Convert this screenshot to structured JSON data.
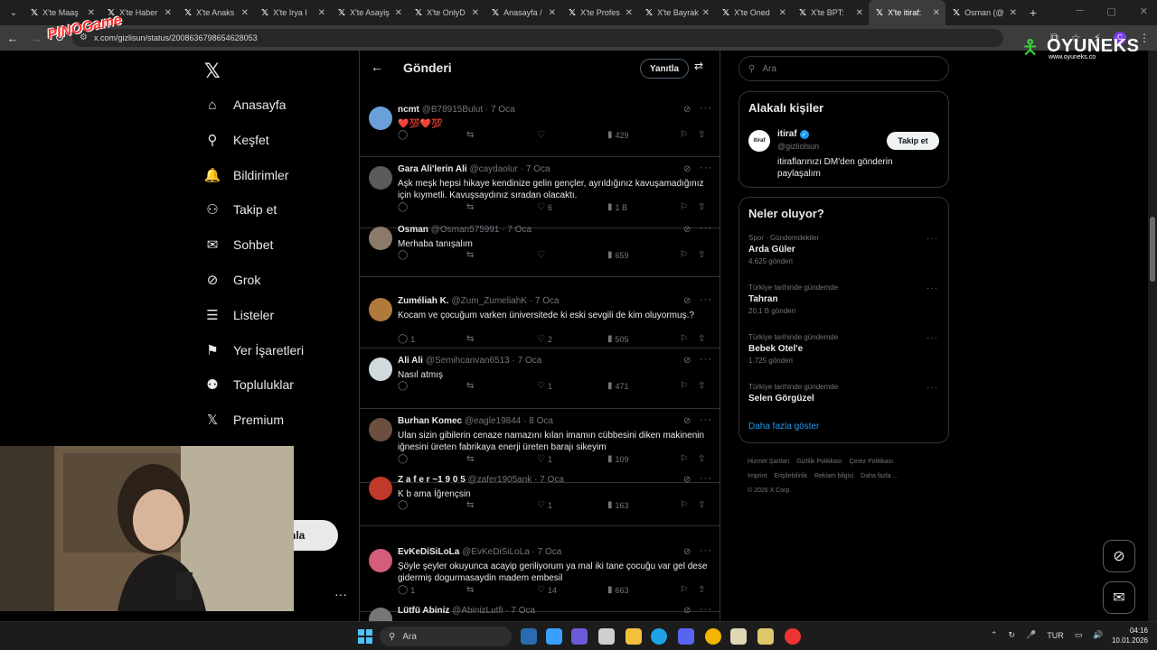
{
  "browser": {
    "tabs": [
      {
        "title": "X'te Maaş",
        "active": false
      },
      {
        "title": "X'te Haber",
        "active": false
      },
      {
        "title": "X'te Anaks",
        "active": false
      },
      {
        "title": "X'te Irya I",
        "active": false
      },
      {
        "title": "X'te Asayiş",
        "active": false
      },
      {
        "title": "X'te OnlyD",
        "active": false
      },
      {
        "title": "Anasayfa /",
        "active": false
      },
      {
        "title": "X'te Profes",
        "active": false
      },
      {
        "title": "X'te Bayrak",
        "active": false
      },
      {
        "title": "X'te Oned",
        "active": false
      },
      {
        "title": "X'te BPT:",
        "active": false
      },
      {
        "title": "X'te itiraf:",
        "active": true
      },
      {
        "title": "Osman (@",
        "active": false
      }
    ],
    "new_tab": "+",
    "url": "x.com/gizlisun/status/2008636798654628053"
  },
  "overlays": {
    "left_logo": "PINOGame",
    "right_logo": "OYUNEKS",
    "right_logo_sub": "www.oyuneks.co"
  },
  "x_nav": {
    "logo": "𝕏",
    "items": [
      {
        "label": "Anasayfa",
        "icon": "home-icon",
        "glyph": "⌂"
      },
      {
        "label": "Keşfet",
        "icon": "search-icon",
        "glyph": "⚲"
      },
      {
        "label": "Bildirimler",
        "icon": "bell-icon",
        "glyph": "🔔"
      },
      {
        "label": "Takip et",
        "icon": "follow-icon",
        "glyph": "⚇"
      },
      {
        "label": "Sohbet",
        "icon": "mail-icon",
        "glyph": "✉"
      },
      {
        "label": "Grok",
        "icon": "grok-icon",
        "glyph": "⊘"
      },
      {
        "label": "Listeler",
        "icon": "list-icon",
        "glyph": "☰"
      },
      {
        "label": "Yer İşaretleri",
        "icon": "bookmark-icon",
        "glyph": "⚑"
      },
      {
        "label": "Topluluklar",
        "icon": "communities-icon",
        "glyph": "⚉"
      },
      {
        "label": "Premium",
        "icon": "x-premium-icon",
        "glyph": "𝕏"
      }
    ],
    "post_button_partial": "nla",
    "more": "···"
  },
  "main": {
    "title": "Gönderi",
    "reply_label": "Yanıtla",
    "tweets": [
      {
        "name": "ncmt",
        "handle": "@B78915Bulut",
        "date": "7 Oca",
        "text": "❤️💯❤️💯",
        "reply": "",
        "retweet": "",
        "like": "",
        "views": "429",
        "av": "#6a9fd8"
      },
      {
        "name": "Gara Ali'lerin Ali",
        "handle": "@caydaolur",
        "date": "7 Oca",
        "text": "Aşk meşk hepsi hikaye kendinize gelin gençler, ayrıldığınız kavuşamadığınız için kıymetli. Kavuşsaydınız sıradan olacaktı.",
        "reply": "",
        "retweet": "",
        "like": "6",
        "views": "1 B",
        "av": "#5a5a5a"
      },
      {
        "name": "Osman",
        "handle": "@Osman575991",
        "date": "7 Oca",
        "text": "Merhaba tanışalım",
        "reply": "",
        "retweet": "",
        "like": "",
        "views": "659",
        "av": "#8b7a6a"
      },
      {
        "name": "Zuméliah K.",
        "handle": "@Zum_ZumeliahK",
        "date": "7 Oca",
        "text": "Kocam ve çocuğum varken üniversitede ki eski sevgili de kim oluyormuş.?",
        "reply": "1",
        "retweet": "",
        "like": "2",
        "views": "505",
        "av": "#b07a3a"
      },
      {
        "name": "Ali Ali",
        "handle": "@Semihcanvan6513",
        "date": "7 Oca",
        "text": "Nasıl atmış",
        "reply": "",
        "retweet": "",
        "like": "1",
        "views": "471",
        "av": "#cfd9de"
      },
      {
        "name": "Burhan Komec",
        "handle": "@eagle19844",
        "date": "8 Oca",
        "text": "Ulan sizin gibilerin cenaze namazını kılan imamın cübbesini diken makinenin iğnesini üreten fabrikaya enerji üreten barajı sikeyim",
        "reply": "",
        "retweet": "",
        "like": "1",
        "views": "109",
        "av": "#6b5040"
      },
      {
        "name": "Z a f e r ~1 9 0 5",
        "handle": "@zafer1905ank",
        "date": "7 Oca",
        "text": "K b ama İğrençsin",
        "reply": "",
        "retweet": "",
        "like": "1",
        "views": "163",
        "av": "#c0392b"
      },
      {
        "name": "EvKeDiSiLoLa",
        "handle": "@EvKeDiSiLoLa",
        "date": "7 Oca",
        "text": "Şöyle şeyler okuyunca acayip geriliyorum ya mal iki tane çocuğu var gel dese gidermiş dogurmasaydin madem  embesil",
        "reply": "1",
        "retweet": "",
        "like": "14",
        "views": "663",
        "av": "#d35d7a"
      },
      {
        "name": "Lütfü Abiniz",
        "handle": "@AbinizLutfi",
        "date": "7 Oca",
        "text": "",
        "reply": "",
        "retweet": "",
        "like": "",
        "views": "",
        "av": "#777"
      }
    ]
  },
  "right": {
    "search_placeholder": "Ara",
    "related_title": "Alakalı kişiler",
    "related": {
      "avatar_text": "itiraf",
      "name": "itiraf",
      "handle": "@gizliolsun",
      "bio": "itiraflarınızı DM'den gönderin paylaşalım",
      "follow_label": "Takip et"
    },
    "trends_title": "Neler oluyor?",
    "trends": [
      {
        "context": "Spor · Gündemdekiler",
        "name": "Arda Güler",
        "count": "4.625 gönderi"
      },
      {
        "context": "Türkiye tarihinde gündemde",
        "name": "Tahran",
        "count": "20,1 B gönderi"
      },
      {
        "context": "Türkiye tarihinde gündemde",
        "name": "Bebek Otel'e",
        "count": "1.725 gönderi"
      },
      {
        "context": "Türkiye tarihinde gündemde",
        "name": "Selen Görgüzel",
        "count": ""
      }
    ],
    "show_more": "Daha fazla göster",
    "footer": [
      "Hizmet Şartları",
      "Gizlilik Politikası",
      "Çerez Politikası",
      "Imprint",
      "Erişilebilirlik",
      "Reklam bilgisi",
      "Daha fazla ...",
      "© 2026 X Corp."
    ]
  },
  "taskbar": {
    "search_placeholder": "Ara",
    "lang": "TUR",
    "time": "04:16",
    "date": "10.01.2026"
  }
}
